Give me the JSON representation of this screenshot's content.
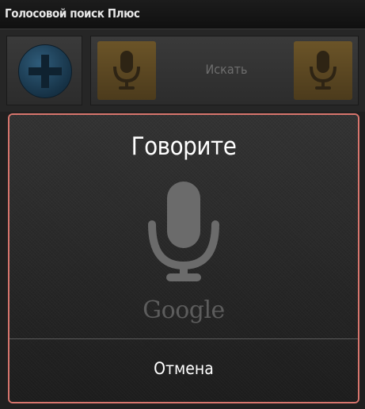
{
  "app": {
    "title": "Голосовой поиск Плюс"
  },
  "toolbar": {
    "search_label": "Искать",
    "plus_icon": "plus-circle-icon",
    "mic_icon": "microphone-icon"
  },
  "dialog": {
    "title": "Говорите",
    "mic_icon": "microphone-icon",
    "brand": "Google",
    "cancel_label": "Отмена"
  },
  "colors": {
    "dialog_border": "#d7756d",
    "mic_tile": "#5a4622",
    "plus_circle": "#1f4560"
  }
}
